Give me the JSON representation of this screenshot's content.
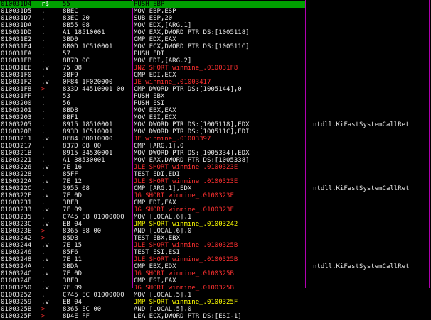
{
  "colors": {
    "background": "#000000",
    "text": "#e6e6e6",
    "selection": "#00a000",
    "conditional_jump": "#ff3030",
    "unconditional_jump": "#ffff00",
    "jump_target_marker": "#ff2e2e",
    "column_divider": "#b000b0"
  },
  "rows": [
    {
      "addr": "010031D4",
      "mark": "r$",
      "hex": "55",
      "asm": "PUSH EBP",
      "cmt": "",
      "kind": "sel"
    },
    {
      "addr": "010031D5",
      "mark": ".",
      "hex": "8BEC",
      "asm": "MOV EBP,ESP",
      "cmt": "",
      "kind": ""
    },
    {
      "addr": "010031D7",
      "mark": ".",
      "hex": "83EC 20",
      "asm": "SUB ESP,20",
      "cmt": "",
      "kind": ""
    },
    {
      "addr": "010031DA",
      "mark": ".",
      "hex": "8B55 08",
      "asm": "MOV EDX,[ARG.1]",
      "cmt": "",
      "kind": ""
    },
    {
      "addr": "010031DD",
      "mark": ".",
      "hex": "A1 18510001",
      "asm": "MOV EAX,DWORD PTR DS:[1005118]",
      "cmt": "",
      "kind": ""
    },
    {
      "addr": "010031E2",
      "mark": ".",
      "hex": "3BD0",
      "asm": "CMP EDX,EAX",
      "cmt": "",
      "kind": ""
    },
    {
      "addr": "010031E4",
      "mark": ".",
      "hex": "8B0D 1C510001",
      "asm": "MOV ECX,DWORD PTR DS:[100511C]",
      "cmt": "",
      "kind": ""
    },
    {
      "addr": "010031EA",
      "mark": ".",
      "hex": "57",
      "asm": "PUSH EDI",
      "cmt": "",
      "kind": ""
    },
    {
      "addr": "010031EB",
      "mark": ".",
      "hex": "8B7D 0C",
      "asm": "MOV EDI,[ARG.2]",
      "cmt": "",
      "kind": ""
    },
    {
      "addr": "010031EE",
      "mark": ".v",
      "hex": "75 08",
      "asm": "JNZ SHORT winmine_.010031F8",
      "cmt": "",
      "kind": "jcc"
    },
    {
      "addr": "010031F0",
      "mark": ".",
      "hex": "3BF9",
      "asm": "CMP EDI,ECX",
      "cmt": "",
      "kind": ""
    },
    {
      "addr": "010031F2",
      "mark": ".v",
      "hex": "0F84 1F020000",
      "asm": "JE winmine_.01003417",
      "cmt": "",
      "kind": "jcc"
    },
    {
      "addr": "010031F8",
      "mark": ">",
      "hex": "833D 44510001 00",
      "asm": "CMP DWORD PTR DS:[1005144],0",
      "cmt": "",
      "kind": "tgt"
    },
    {
      "addr": "010031FF",
      "mark": ".",
      "hex": "53",
      "asm": "PUSH EBX",
      "cmt": "",
      "kind": ""
    },
    {
      "addr": "01003200",
      "mark": ".",
      "hex": "56",
      "asm": "PUSH ESI",
      "cmt": "",
      "kind": ""
    },
    {
      "addr": "01003201",
      "mark": ".",
      "hex": "8BD8",
      "asm": "MOV EBX,EAX",
      "cmt": "",
      "kind": ""
    },
    {
      "addr": "01003203",
      "mark": ".",
      "hex": "8BF1",
      "asm": "MOV ESI,ECX",
      "cmt": "",
      "kind": ""
    },
    {
      "addr": "01003205",
      "mark": ".",
      "hex": "8915 18510001",
      "asm": "MOV DWORD PTR DS:[1005118],EDX",
      "cmt": "ntdll.KiFastSystemCallRet",
      "kind": ""
    },
    {
      "addr": "0100320B",
      "mark": ".",
      "hex": "893D 1C510001",
      "asm": "MOV DWORD PTR DS:[100511C],EDI",
      "cmt": "",
      "kind": ""
    },
    {
      "addr": "01003211",
      "mark": ".v",
      "hex": "0F84 80010000",
      "asm": "JE winmine_.01003397",
      "cmt": "",
      "kind": "jcc"
    },
    {
      "addr": "01003217",
      "mark": ".",
      "hex": "837D 08 00",
      "asm": "CMP [ARG.1],0",
      "cmt": "",
      "kind": ""
    },
    {
      "addr": "0100321B",
      "mark": ".",
      "hex": "8915 34530001",
      "asm": "MOV DWORD PTR DS:[1005334],EDX",
      "cmt": "",
      "kind": ""
    },
    {
      "addr": "01003221",
      "mark": ".",
      "hex": "A1 38530001",
      "asm": "MOV EAX,DWORD PTR DS:[1005338]",
      "cmt": "",
      "kind": ""
    },
    {
      "addr": "01003226",
      "mark": ".v",
      "hex": "7E 16",
      "asm": "JLE SHORT winmine_.0100323E",
      "cmt": "",
      "kind": "jcc"
    },
    {
      "addr": "01003228",
      "mark": ".",
      "hex": "85FF",
      "asm": "TEST EDI,EDI",
      "cmt": "",
      "kind": ""
    },
    {
      "addr": "0100322A",
      "mark": ".v",
      "hex": "7E 12",
      "asm": "JLE SHORT winmine_.0100323E",
      "cmt": "",
      "kind": "jcc"
    },
    {
      "addr": "0100322C",
      "mark": ".",
      "hex": "3955 08",
      "asm": "CMP [ARG.1],EDX",
      "cmt": "ntdll.KiFastSystemCallRet",
      "kind": ""
    },
    {
      "addr": "0100322F",
      "mark": ".v",
      "hex": "7F 0D",
      "asm": "JG SHORT winmine_.0100323E",
      "cmt": "",
      "kind": "jcc"
    },
    {
      "addr": "01003231",
      "mark": ".",
      "hex": "3BF8",
      "asm": "CMP EDI,EAX",
      "cmt": "",
      "kind": ""
    },
    {
      "addr": "01003233",
      "mark": ".v",
      "hex": "7F 09",
      "asm": "JG SHORT winmine_.0100323E",
      "cmt": "",
      "kind": "jcc"
    },
    {
      "addr": "01003235",
      "mark": ".",
      "hex": "C745 E8 01000000",
      "asm": "MOV [LOCAL.6],1",
      "cmt": "",
      "kind": ""
    },
    {
      "addr": "0100323C",
      "mark": ".v",
      "hex": "EB 04",
      "asm": "JMP SHORT winmine_.01003242",
      "cmt": "",
      "kind": "jmp"
    },
    {
      "addr": "0100323E",
      "mark": ">",
      "hex": "8365 E8 00",
      "asm": "AND [LOCAL.6],0",
      "cmt": "",
      "kind": "tgt"
    },
    {
      "addr": "01003242",
      "mark": ">",
      "hex": "85DB",
      "asm": "TEST EBX,EBX",
      "cmt": "",
      "kind": "tgt"
    },
    {
      "addr": "01003244",
      "mark": ".v",
      "hex": "7E 15",
      "asm": "JLE SHORT winmine_.0100325B",
      "cmt": "",
      "kind": "jcc"
    },
    {
      "addr": "01003246",
      "mark": ".",
      "hex": "85F6",
      "asm": "TEST ESI,ESI",
      "cmt": "",
      "kind": ""
    },
    {
      "addr": "01003248",
      "mark": ".v",
      "hex": "7E 11",
      "asm": "JLE SHORT winmine_.0100325B",
      "cmt": "",
      "kind": "jcc"
    },
    {
      "addr": "0100324A",
      "mark": ".",
      "hex": "3BDA",
      "asm": "CMP EBX,EDX",
      "cmt": "ntdll.KiFastSystemCallRet",
      "kind": ""
    },
    {
      "addr": "0100324C",
      "mark": ".v",
      "hex": "7F 0D",
      "asm": "JG SHORT winmine_.0100325B",
      "cmt": "",
      "kind": "jcc"
    },
    {
      "addr": "0100324E",
      "mark": ".",
      "hex": "3BF0",
      "asm": "CMP ESI,EAX",
      "cmt": "",
      "kind": ""
    },
    {
      "addr": "01003250",
      "mark": ".v",
      "hex": "7F 09",
      "asm": "JG SHORT winmine_.0100325B",
      "cmt": "",
      "kind": "jcc"
    },
    {
      "addr": "01003252",
      "mark": ".",
      "hex": "C745 EC 01000000",
      "asm": "MOV [LOCAL.5],1",
      "cmt": "",
      "kind": ""
    },
    {
      "addr": "01003259",
      "mark": ".v",
      "hex": "EB 04",
      "asm": "JMP SHORT winmine_.0100325F",
      "cmt": "",
      "kind": "jmp"
    },
    {
      "addr": "0100325B",
      "mark": ">",
      "hex": "8365 EC 00",
      "asm": "AND [LOCAL.5],0",
      "cmt": "",
      "kind": "tgt"
    },
    {
      "addr": "0100325F",
      "mark": ">",
      "hex": "8D4E FF",
      "asm": "LEA ECX,DWORD PTR DS:[ESI-1]",
      "cmt": "",
      "kind": "tgt"
    }
  ]
}
